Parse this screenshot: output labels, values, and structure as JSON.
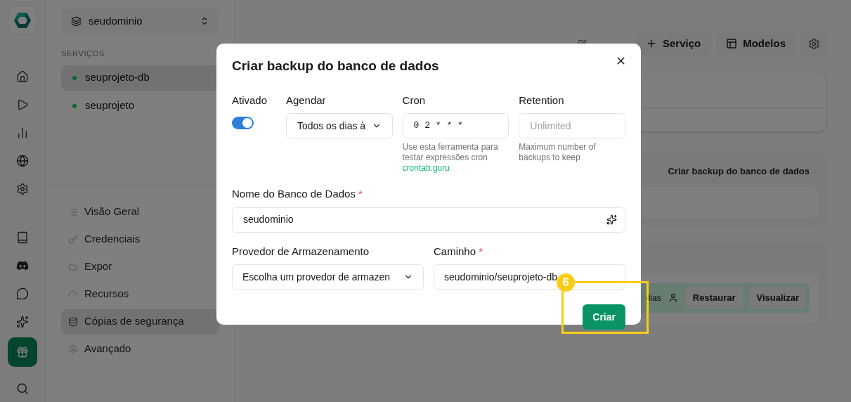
{
  "project_selector": {
    "value": "seudominio"
  },
  "services": {
    "heading": "SERVIÇOS",
    "items": [
      {
        "name": "seuprojeto-db",
        "selected": true
      },
      {
        "name": "seuprojeto",
        "selected": false
      }
    ]
  },
  "nav": [
    {
      "label": "Visão Geral",
      "selected": false
    },
    {
      "label": "Credenciais",
      "selected": false
    },
    {
      "label": "Expor",
      "selected": false
    },
    {
      "label": "Recursos",
      "selected": false
    },
    {
      "label": "Cópias de segurança",
      "selected": true
    },
    {
      "label": "Avançado",
      "selected": false
    }
  ],
  "page": {
    "actions": [
      {
        "label": "Serviço"
      },
      {
        "label": "Modelos"
      }
    ],
    "tabs": [
      {
        "label": "Criar backup do banco de dados"
      }
    ],
    "backup_row": {
      "text": "dias",
      "actions": [
        {
          "label": "Restaurar"
        },
        {
          "label": "Visualizar"
        }
      ]
    }
  },
  "dialog": {
    "title": "Criar backup do banco de dados",
    "enabled": {
      "label": "Ativado",
      "on": true
    },
    "schedule": {
      "label": "Agendar",
      "value": "Todos os dias à"
    },
    "cron": {
      "label": "Cron",
      "value": "0 2 * * *",
      "help": "Use esta ferramenta para testar expressões cron",
      "link": "crontab.guru"
    },
    "retention": {
      "label": "Retention",
      "placeholder": "Unlimited",
      "help": "Maximum number of backups to keep"
    },
    "database_name": {
      "label": "Nome do Banco de Dados",
      "required_mark": "*",
      "value": "seudominio"
    },
    "storage_provider": {
      "label": "Provedor de Armazenamento",
      "value": "Escolha um provedor de armazen"
    },
    "path": {
      "label": "Caminho",
      "required_mark": "*",
      "value": "seudominio/seuprojeto-db"
    },
    "submit": "Criar"
  },
  "annotation": {
    "number": "6"
  }
}
